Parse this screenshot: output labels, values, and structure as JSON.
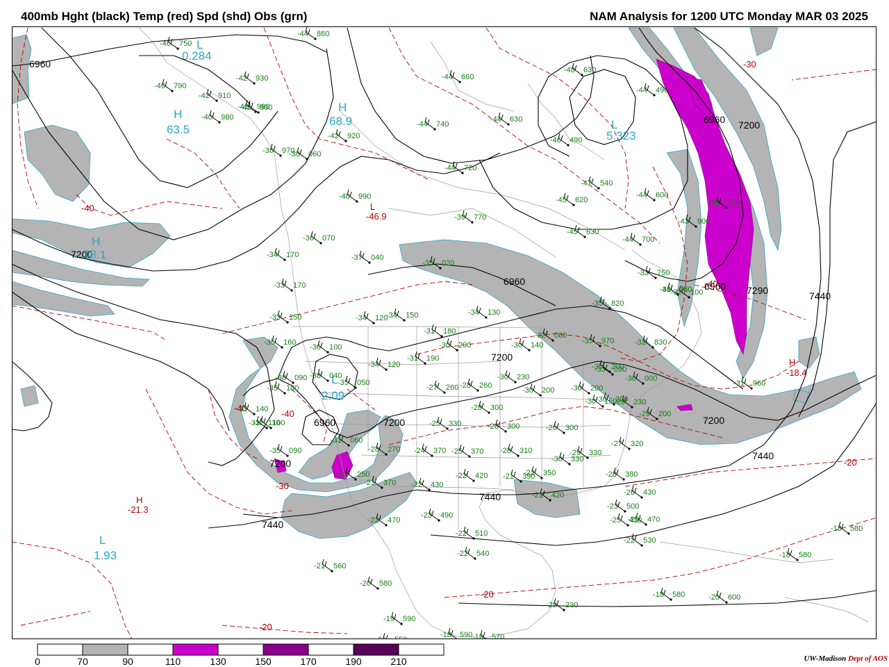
{
  "header": {
    "title_left": "400mb Hght (black) Temp (red) Spd (shd) Obs (grn)",
    "title_right": "NAM Analysis for 1200 UTC Monday  MAR 03 2025"
  },
  "colors": {
    "height_contour": "#000000",
    "temp_contour": "#b00000",
    "speed_70_90": "#b4b4b4",
    "speed_110_130": "#cc00cc",
    "speed_150_170": "#8b008b",
    "speed_190_210": "#5a005a",
    "obs_text": "#147a14",
    "center_label": "#2aa6c9",
    "map_lines": "#999999"
  },
  "colorbar": {
    "labels": [
      "0",
      "70",
      "90",
      "110",
      "130",
      "150",
      "170",
      "190",
      "210"
    ],
    "fills": [
      "#ffffff",
      "#b4b4b4",
      "#ffffff",
      "#cc00cc",
      "#ffffff",
      "#8b008b",
      "#ffffff",
      "#5a005a",
      "#ffffff"
    ]
  },
  "height_labels": [
    "6960",
    "7200",
    "6960",
    "7200",
    "7200",
    "6960",
    "7200",
    "7440",
    "7440",
    "7440",
    "7200",
    "7290",
    "6960",
    "7440",
    "6960",
    "7200"
  ],
  "temp_labels": [
    "-30",
    "-40",
    "-40",
    "-20",
    "-20",
    "-20",
    "-40",
    "-30",
    "-46.9",
    "-21.3",
    "-18.4",
    "-40"
  ],
  "centers": [
    {
      "type": "L",
      "value": "0.284"
    },
    {
      "type": "H",
      "value": "63.5"
    },
    {
      "type": "H",
      "value": "68.9"
    },
    {
      "type": "L",
      "value": "5.323"
    },
    {
      "type": "H",
      "value": "18.1"
    },
    {
      "type": "L",
      "value": "1.93"
    },
    {
      "type": "L",
      "value": "2.09"
    },
    {
      "type": "H",
      "value": "21.3"
    },
    {
      "type": "H",
      "value": "18.4"
    },
    {
      "type": "L",
      "value": "46.9"
    }
  ],
  "observations": [
    {
      "t": "-46",
      "z": "750"
    },
    {
      "t": "-44",
      "z": "860"
    },
    {
      "t": "-44",
      "z": "660"
    },
    {
      "t": "-48",
      "z": "630"
    },
    {
      "t": "-46",
      "z": "790"
    },
    {
      "t": "-42",
      "z": "930"
    },
    {
      "t": "-42",
      "z": "910"
    },
    {
      "t": "-44",
      "z": "490"
    },
    {
      "t": "-42",
      "z": "900"
    },
    {
      "t": "-42",
      "z": "990"
    },
    {
      "t": "-44",
      "z": "740"
    },
    {
      "t": "-44",
      "z": "630"
    },
    {
      "t": "-40",
      "z": "980"
    },
    {
      "t": "-42",
      "z": "920"
    },
    {
      "t": "-46",
      "z": "490"
    },
    {
      "t": "-36",
      "z": "970"
    },
    {
      "t": "-38",
      "z": "060"
    },
    {
      "t": "-44",
      "z": "720"
    },
    {
      "t": "-47",
      "z": "540"
    },
    {
      "t": "-44",
      "z": "600"
    },
    {
      "t": "-40",
      "z": "990"
    },
    {
      "t": "-45",
      "z": "620"
    },
    {
      "t": "-36",
      "z": "070"
    },
    {
      "t": "-45",
      "z": "630"
    },
    {
      "t": "-44",
      "z": "700"
    },
    {
      "t": "-39",
      "z": "770"
    },
    {
      "t": "-37",
      "z": "040"
    },
    {
      "t": "-34",
      "z": "170"
    },
    {
      "t": "-35",
      "z": "020"
    },
    {
      "t": "-33",
      "z": "170"
    },
    {
      "t": "-34",
      "z": "130"
    },
    {
      "t": "-35",
      "z": "820"
    },
    {
      "t": "-33",
      "z": "750"
    },
    {
      "t": "-31",
      "z": "780"
    },
    {
      "t": "-33",
      "z": "150"
    },
    {
      "t": "-34",
      "z": "120"
    },
    {
      "t": "-34",
      "z": "150"
    },
    {
      "t": "-31",
      "z": "180"
    },
    {
      "t": "-35",
      "z": "970"
    },
    {
      "t": "-35",
      "z": "160"
    },
    {
      "t": "-36",
      "z": "100"
    },
    {
      "t": "-30",
      "z": "200"
    },
    {
      "t": "-30",
      "z": "140"
    },
    {
      "t": "-32",
      "z": "080"
    },
    {
      "t": "-32",
      "z": "830"
    },
    {
      "t": "-31",
      "z": "190"
    },
    {
      "t": "-34",
      "z": "120"
    },
    {
      "t": "-38",
      "z": "090"
    },
    {
      "t": "-38",
      "z": "040"
    },
    {
      "t": "-35",
      "z": "050"
    },
    {
      "t": "-30",
      "z": "230"
    },
    {
      "t": "-33",
      "z": "090"
    },
    {
      "t": "-30",
      "z": "000"
    },
    {
      "t": "-35",
      "z": "100"
    },
    {
      "t": "-27",
      "z": "260"
    },
    {
      "t": "-28",
      "z": "260"
    },
    {
      "t": "-30",
      "z": "200"
    },
    {
      "t": "-30",
      "z": "200"
    },
    {
      "t": "-30",
      "z": "150"
    },
    {
      "t": "-29",
      "z": "230"
    },
    {
      "t": "-30",
      "z": "200"
    },
    {
      "t": "-33",
      "z": "140"
    },
    {
      "t": "-32",
      "z": "100"
    },
    {
      "t": "-25",
      "z": "330"
    },
    {
      "t": "-28",
      "z": "300"
    },
    {
      "t": "-28",
      "z": "300"
    },
    {
      "t": "-26",
      "z": "300"
    },
    {
      "t": "-29",
      "z": "200"
    },
    {
      "t": "-31",
      "z": "060"
    },
    {
      "t": "-28",
      "z": "270"
    },
    {
      "t": "-24",
      "z": "370"
    },
    {
      "t": "-25",
      "z": "370"
    },
    {
      "t": "-28",
      "z": "310"
    },
    {
      "t": "-30",
      "z": "330"
    },
    {
      "t": "-29",
      "z": "330"
    },
    {
      "t": "-27",
      "z": "320"
    },
    {
      "t": "-28",
      "z": "250"
    },
    {
      "t": "-23",
      "z": "370"
    },
    {
      "t": "-22",
      "z": "420"
    },
    {
      "t": "-22",
      "z": "430"
    },
    {
      "t": "-21",
      "z": "390"
    },
    {
      "t": "-22",
      "z": "350"
    },
    {
      "t": "-21",
      "z": "420"
    },
    {
      "t": "-28",
      "z": "380"
    },
    {
      "t": "-26",
      "z": "430"
    },
    {
      "t": "-23",
      "z": "490"
    },
    {
      "t": "-22",
      "z": "470"
    },
    {
      "t": "-22",
      "z": "510"
    },
    {
      "t": "-25",
      "z": "430"
    },
    {
      "t": "-25",
      "z": "470"
    },
    {
      "t": "-23",
      "z": "500"
    },
    {
      "t": "-22",
      "z": "530"
    },
    {
      "t": "-22",
      "z": "540"
    },
    {
      "t": "-21",
      "z": "560"
    },
    {
      "t": "-20",
      "z": "580"
    },
    {
      "t": "-19",
      "z": "590"
    },
    {
      "t": "-21",
      "z": "550"
    },
    {
      "t": "-18",
      "z": "590"
    },
    {
      "t": "-19",
      "z": "570"
    },
    {
      "t": "-18",
      "z": "580"
    },
    {
      "t": "-20",
      "z": "600"
    },
    {
      "t": "-18",
      "z": "580"
    },
    {
      "t": "-18",
      "z": "580"
    },
    {
      "t": "-29",
      "z": "230"
    },
    {
      "t": "-31",
      "z": "960"
    },
    {
      "t": "-38",
      "z": "770"
    },
    {
      "t": "-43",
      "z": "900"
    },
    {
      "t": "-46",
      "z": "760"
    },
    {
      "t": "-32",
      "z": "100"
    },
    {
      "t": "-31",
      "z": "110"
    },
    {
      "t": "-35",
      "z": "090"
    },
    {
      "t": "-35",
      "z": "200"
    }
  ],
  "credit": {
    "org": "UW-Madison",
    "dept": "Dept of AOS"
  }
}
